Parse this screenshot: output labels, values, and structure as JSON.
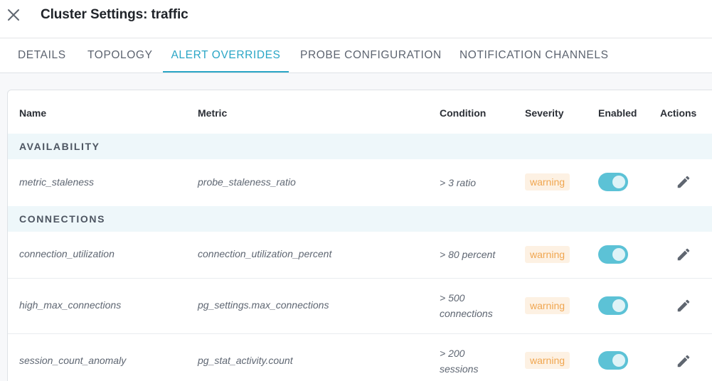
{
  "header": {
    "title": "Cluster Settings: traffic",
    "close_icon": "close-icon"
  },
  "tabs": [
    {
      "label": "DETAILS",
      "active": false
    },
    {
      "label": "TOPOLOGY",
      "active": false
    },
    {
      "label": "ALERT OVERRIDES",
      "active": true
    },
    {
      "label": "PROBE CONFIGURATION",
      "active": false
    },
    {
      "label": "NOTIFICATION CHANNELS",
      "active": false
    }
  ],
  "table": {
    "columns": {
      "name": "Name",
      "metric": "Metric",
      "condition": "Condition",
      "severity": "Severity",
      "enabled": "Enabled",
      "actions": "Actions"
    },
    "groups": [
      {
        "label": "AVAILABILITY",
        "rows": [
          {
            "name": "metric_staleness",
            "metric": "probe_staleness_ratio",
            "condition_line1": "> 3 ratio",
            "condition_line2": "",
            "severity": "warning",
            "enabled": true
          }
        ]
      },
      {
        "label": "CONNECTIONS",
        "rows": [
          {
            "name": "connection_utilization",
            "metric": "connection_utilization_percent",
            "condition_line1": "> 80 percent",
            "condition_line2": "",
            "severity": "warning",
            "enabled": true
          },
          {
            "name": "high_max_connections",
            "metric": "pg_settings.max_connections",
            "condition_line1": "> 500",
            "condition_line2": "connections",
            "severity": "warning",
            "enabled": true
          },
          {
            "name": "session_count_anomaly",
            "metric": "pg_stat_activity.count",
            "condition_line1": "> 200",
            "condition_line2": "sessions",
            "severity": "warning",
            "enabled": true
          }
        ]
      }
    ]
  },
  "colors": {
    "accent": "#2aa6c6",
    "toggle_on": "#5cc2d6",
    "warning_text": "#f0a650",
    "warning_bg": "#fdf1e3",
    "group_bg": "#eef7fa"
  },
  "icons": {
    "edit": "pencil-icon",
    "close": "close-icon"
  }
}
